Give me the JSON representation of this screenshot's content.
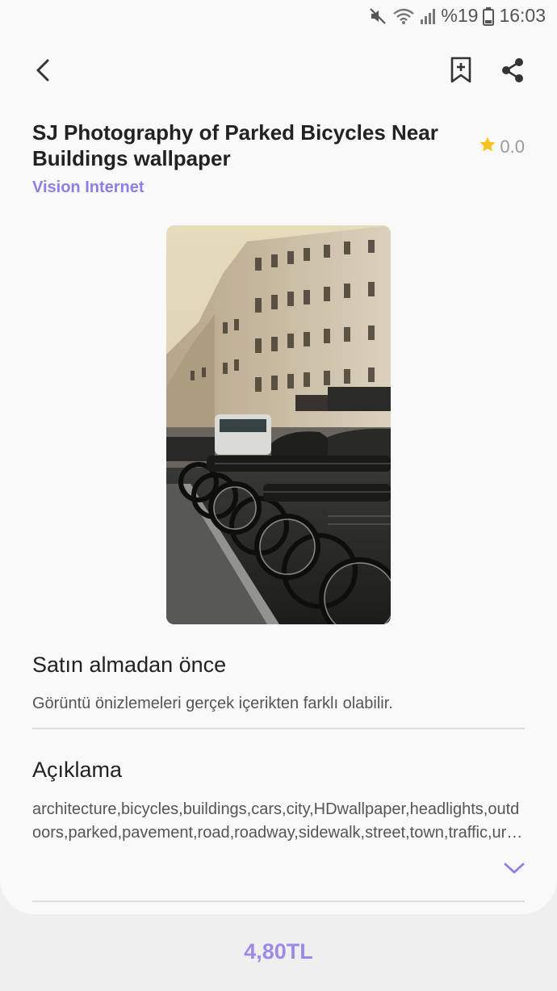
{
  "status_bar": {
    "battery": "%19",
    "time": "16:03",
    "icons": [
      "mute-icon",
      "wifi-icon",
      "signal-icon",
      "battery-icon"
    ]
  },
  "app_bar": {
    "icons": [
      "back-arrow-icon",
      "bookmark-add-icon",
      "share-icon"
    ]
  },
  "product": {
    "title": "SJ Photography of Parked Bicycles Near Buildings wallpaper",
    "rating": "0.0",
    "publisher": "Vision Internet"
  },
  "before_buying": {
    "heading": "Satın almadan önce",
    "text": "Görüntü önizlemeleri gerçek içerikten farklı olabilir."
  },
  "description": {
    "heading": "Açıklama",
    "text": "architecture,bicycles,buildings,cars,city,HDwallpaper,headlights,outdoors,parked,pavement,road,roadway,sidewalk,street,town,traffic,urban,vehicles"
  },
  "price": "4,80TL",
  "colors": {
    "accent": "#8f7ee3",
    "star": "#f7c21b",
    "background": "#f9f9f9"
  }
}
